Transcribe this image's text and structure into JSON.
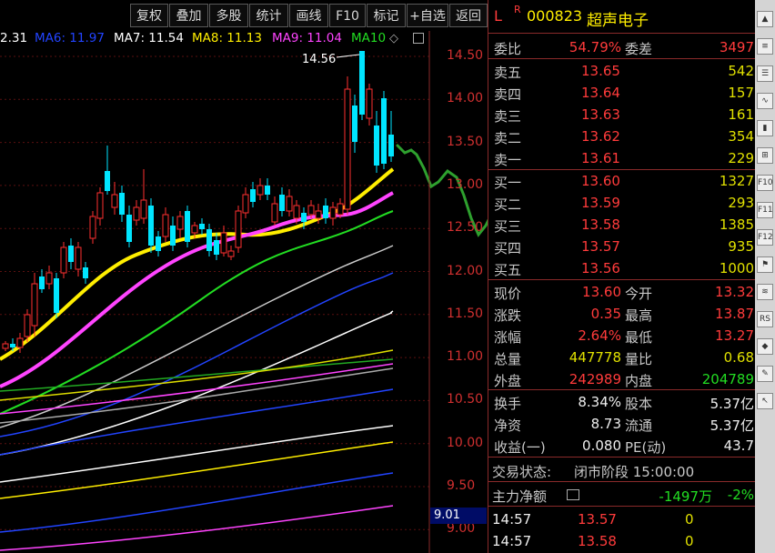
{
  "toolbar": {
    "buttons": [
      "复权",
      "叠加",
      "多股",
      "统计",
      "画线",
      "F10",
      "标记",
      "+自选",
      "返回"
    ]
  },
  "ma_legend": [
    {
      "label": "2.31",
      "color": "#ffffff"
    },
    {
      "label": "MA6: 11.97",
      "color": "#2244ff"
    },
    {
      "label": "MA7: 11.54",
      "color": "#ffffff"
    },
    {
      "label": "MA8: 11.13",
      "color": "#ffee00"
    },
    {
      "label": "MA9: 11.04",
      "color": "#ff44ff"
    },
    {
      "label": "MA10",
      "color": "#22dd22"
    }
  ],
  "chart": {
    "peak_label": "14.56",
    "price_labels": [
      "14.50",
      "14.00",
      "13.50",
      "13.00",
      "12.50",
      "12.00",
      "11.50",
      "11.00",
      "10.50",
      "10.00",
      "9.50",
      "9.00"
    ],
    "cursor_price": "9.01"
  },
  "quote": {
    "header": {
      "l": "L",
      "r": "R",
      "code": "000823",
      "name": "超声电子"
    },
    "weibi": {
      "label": "委比",
      "value": "54.79%",
      "label2": "委差",
      "value2": "3497"
    },
    "sell": [
      {
        "label": "卖五",
        "price": "13.65",
        "vol": "542"
      },
      {
        "label": "卖四",
        "price": "13.64",
        "vol": "157"
      },
      {
        "label": "卖三",
        "price": "13.63",
        "vol": "161"
      },
      {
        "label": "卖二",
        "price": "13.62",
        "vol": "354"
      },
      {
        "label": "卖一",
        "price": "13.61",
        "vol": "229"
      }
    ],
    "buy": [
      {
        "label": "买一",
        "price": "13.60",
        "vol": "1327"
      },
      {
        "label": "买二",
        "price": "13.59",
        "vol": "293"
      },
      {
        "label": "买三",
        "price": "13.58",
        "vol": "1385"
      },
      {
        "label": "买四",
        "price": "13.57",
        "vol": "935"
      },
      {
        "label": "买五",
        "price": "13.56",
        "vol": "1000"
      }
    ],
    "stats": [
      {
        "l1": "现价",
        "v1": "13.60",
        "c1": "red",
        "l2": "今开",
        "v2": "13.32",
        "c2": "red"
      },
      {
        "l1": "涨跌",
        "v1": "0.35",
        "c1": "red",
        "l2": "最高",
        "v2": "13.87",
        "c2": "red"
      },
      {
        "l1": "涨幅",
        "v1": "2.64%",
        "c1": "red",
        "l2": "最低",
        "v2": "13.27",
        "c2": "red"
      },
      {
        "l1": "总量",
        "v1": "447778",
        "c1": "yel",
        "l2": "量比",
        "v2": "0.68",
        "c2": "yel"
      },
      {
        "l1": "外盘",
        "v1": "242989",
        "c1": "red",
        "l2": "内盘",
        "v2": "204789",
        "c2": "grn"
      }
    ],
    "stats2": [
      {
        "l1": "换手",
        "v1": "8.34%",
        "l2": "股本",
        "v2": "5.37亿"
      },
      {
        "l1": "净资",
        "v1": "8.73",
        "l2": "流通",
        "v2": "5.37亿"
      },
      {
        "l1": "收益(一)",
        "v1": "0.080",
        "l2": "PE(动)",
        "v2": "43.7"
      }
    ],
    "status": {
      "label": "交易状态:",
      "value": "闭市阶段 15:00:00"
    },
    "net_flow": {
      "label": "主力净额",
      "value": "-1497万",
      "pct": "-2%"
    },
    "ticks": [
      {
        "time": "14:57",
        "price": "13.57",
        "vol": "0"
      },
      {
        "time": "14:57",
        "price": "13.58",
        "vol": "0"
      }
    ]
  },
  "strip_icons": [
    "arrow-icon",
    "menu-icon",
    "list-icon",
    "chart-icon",
    "kline-icon",
    "grid-icon",
    "f10-icon",
    "f11-icon",
    "f12-icon",
    "flag-icon",
    "lines-icon",
    "rss-icon",
    "expand-icon",
    "pen-icon",
    "cursor-icon"
  ]
}
